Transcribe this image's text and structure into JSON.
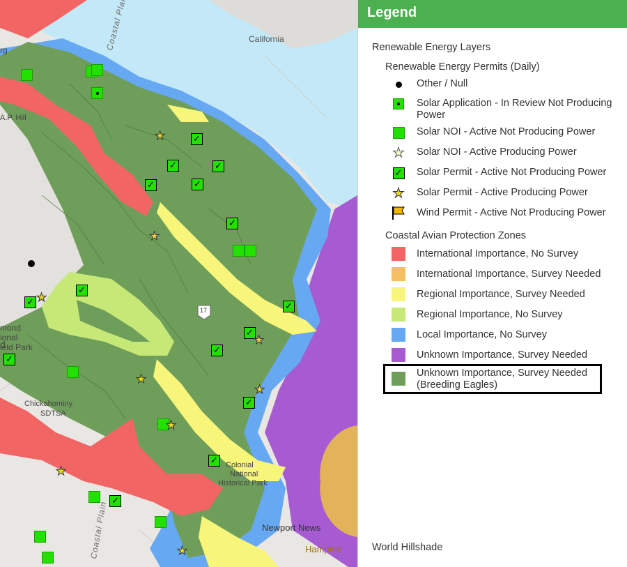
{
  "legend": {
    "header": "Legend",
    "group_title": "Renewable Energy Layers",
    "permits": {
      "title": "Renewable Energy Permits (Daily)",
      "items": [
        {
          "label": "Other / Null",
          "icon": "black-dot-icon"
        },
        {
          "label": "Solar Application - In Review Not Producing Power",
          "icon": "green-square-dot-icon"
        },
        {
          "label": "Solar NOI - Active Not Producing Power",
          "icon": "green-square-icon"
        },
        {
          "label": "Solar NOI - Active Producing Power",
          "icon": "hollow-star-icon"
        },
        {
          "label": "Solar Permit - Active Not Producing Power",
          "icon": "green-check-square-icon"
        },
        {
          "label": "Solar Permit - Active Producing Power",
          "icon": "yellow-star-icon"
        },
        {
          "label": "Wind Permit - Active Not Producing Power",
          "icon": "orange-flag-icon"
        }
      ]
    },
    "zones": {
      "title": "Coastal Avian Protection Zones",
      "items": [
        {
          "label": "International Importance, No Survey",
          "color": "#f26565"
        },
        {
          "label": "International Importance, Survey Needed",
          "color": "#f5bf64"
        },
        {
          "label": "Regional Importance, Survey Needed",
          "color": "#f7f57a"
        },
        {
          "label": "Regional Importance, No Survey",
          "color": "#c5e876"
        },
        {
          "label": "Local Importance, No Survey",
          "color": "#66a8f2"
        },
        {
          "label": "Unknown Importance, Survey Needed",
          "color": "#a65bd3"
        },
        {
          "label": "Unknown Importance, Survey Needed (Breeding Eagles)",
          "color": "#6f9e5b"
        }
      ]
    },
    "basemap": "World Hillshade"
  },
  "map": {
    "labels": {
      "california": "California",
      "coastal_plain_top": "Coastal Plain",
      "coastal_plain_bottom": "Coastal Plain",
      "ap_hill": "A.P. Hill",
      "frag_rg": "rg",
      "richmond_1": "mond",
      "richmond_2": "ional",
      "richmond_3": "ield Park",
      "richmond_4": "d",
      "chickahominy": "Chickahominy",
      "sdtsa": "SDTSA",
      "colonial_1": "Colonial",
      "colonial_2": "National",
      "colonial_3": "Historical Park",
      "newport_news": "Newport News",
      "hampton": "Hampton",
      "route": "17"
    },
    "colors": {
      "water": "#c3e8f7",
      "land": "#e9e7e3",
      "eagles": "#6f9e5b",
      "local": "#66a8f2",
      "international": "#f26565",
      "regional_survey": "#f7f57a",
      "regional_no_survey": "#c5e876",
      "unknown": "#a65bd3",
      "intl_survey": "#e3b35a"
    }
  }
}
